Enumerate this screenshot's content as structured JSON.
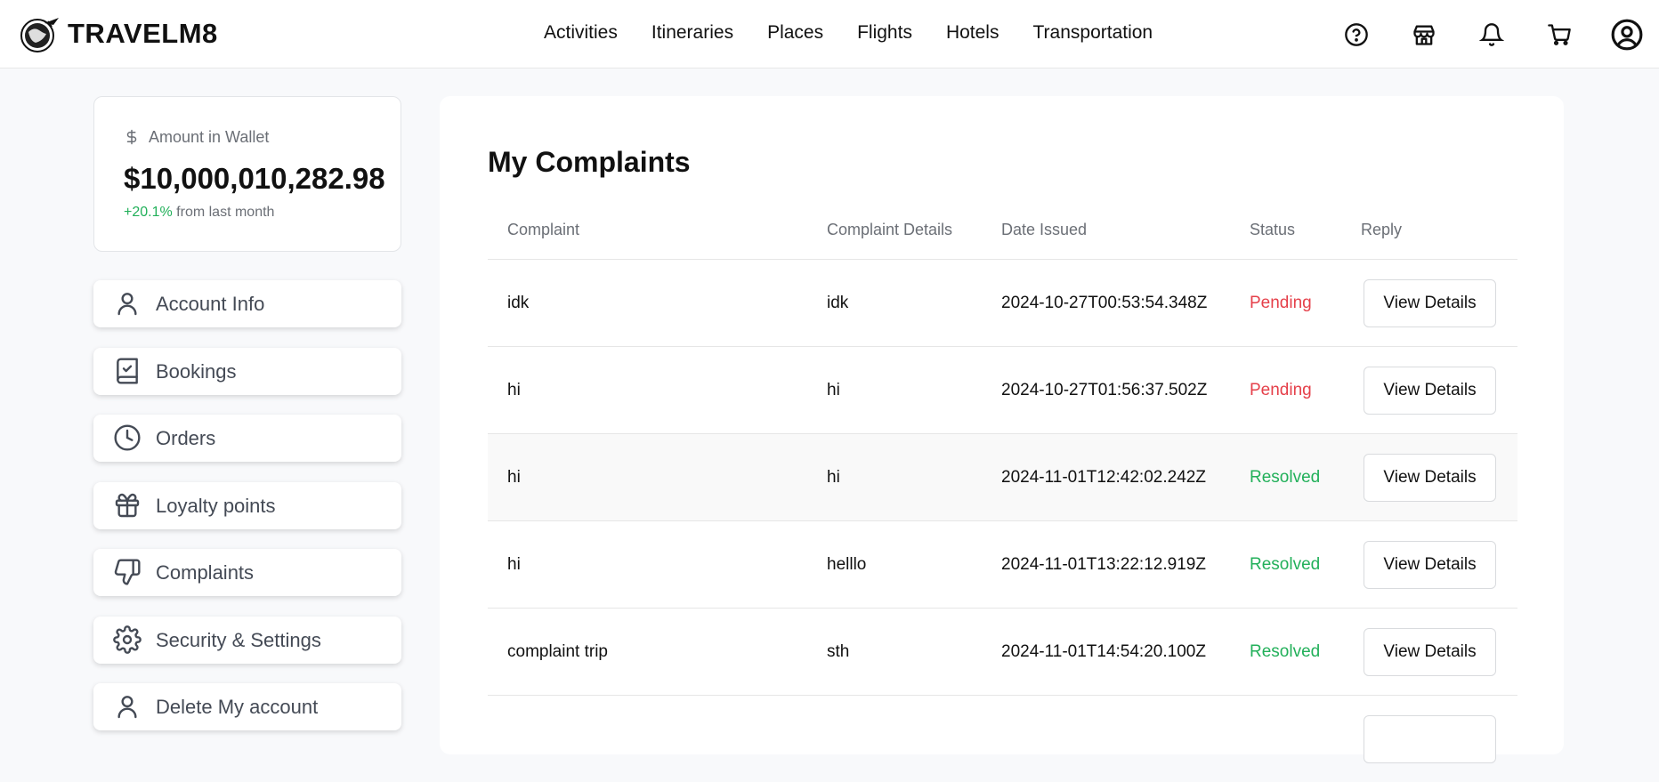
{
  "app": {
    "logo_text": "TRAVELM8"
  },
  "nav": {
    "items": [
      "Activities",
      "Itineraries",
      "Places",
      "Flights",
      "Hotels",
      "Transportation"
    ]
  },
  "top_icons": [
    "help-icon",
    "store-icon",
    "bell-icon",
    "cart-icon",
    "profile-icon"
  ],
  "wallet": {
    "label": "Amount in Wallet",
    "amount": "$10,000,010,282.98",
    "change_pct": "+20.1%",
    "change_text": "from last month"
  },
  "sidebar": {
    "items": [
      {
        "label": "Account Info",
        "icon": "user-icon"
      },
      {
        "label": "Bookings",
        "icon": "book-check-icon"
      },
      {
        "label": "Orders",
        "icon": "clock-icon"
      },
      {
        "label": "Loyalty points",
        "icon": "gift-icon"
      },
      {
        "label": "Complaints",
        "icon": "thumbs-down-icon"
      },
      {
        "label": "Security & Settings",
        "icon": "gear-icon"
      },
      {
        "label": "Delete My account",
        "icon": "user-icon"
      }
    ]
  },
  "complaints": {
    "title": "My Complaints",
    "columns": [
      "Complaint",
      "Complaint Details",
      "Date Issued",
      "Status",
      "Reply"
    ],
    "rows": [
      {
        "complaint": "idk",
        "details": "idk",
        "date": "2024-10-27T00:53:54.348Z",
        "status": "Pending",
        "action": "View Details"
      },
      {
        "complaint": "hi",
        "details": "hi",
        "date": "2024-10-27T01:56:37.502Z",
        "status": "Pending",
        "action": "View Details"
      },
      {
        "complaint": "hi",
        "details": "hi",
        "date": "2024-11-01T12:42:02.242Z",
        "status": "Resolved",
        "action": "View Details"
      },
      {
        "complaint": "hi",
        "details": "helllo",
        "date": "2024-11-01T13:22:12.919Z",
        "status": "Resolved",
        "action": "View Details"
      },
      {
        "complaint": "complaint trip",
        "details": "sth",
        "date": "2024-11-01T14:54:20.100Z",
        "status": "Resolved",
        "action": "View Details"
      }
    ]
  },
  "colors": {
    "pending": "#e5404a",
    "resolved": "#22b05a"
  }
}
